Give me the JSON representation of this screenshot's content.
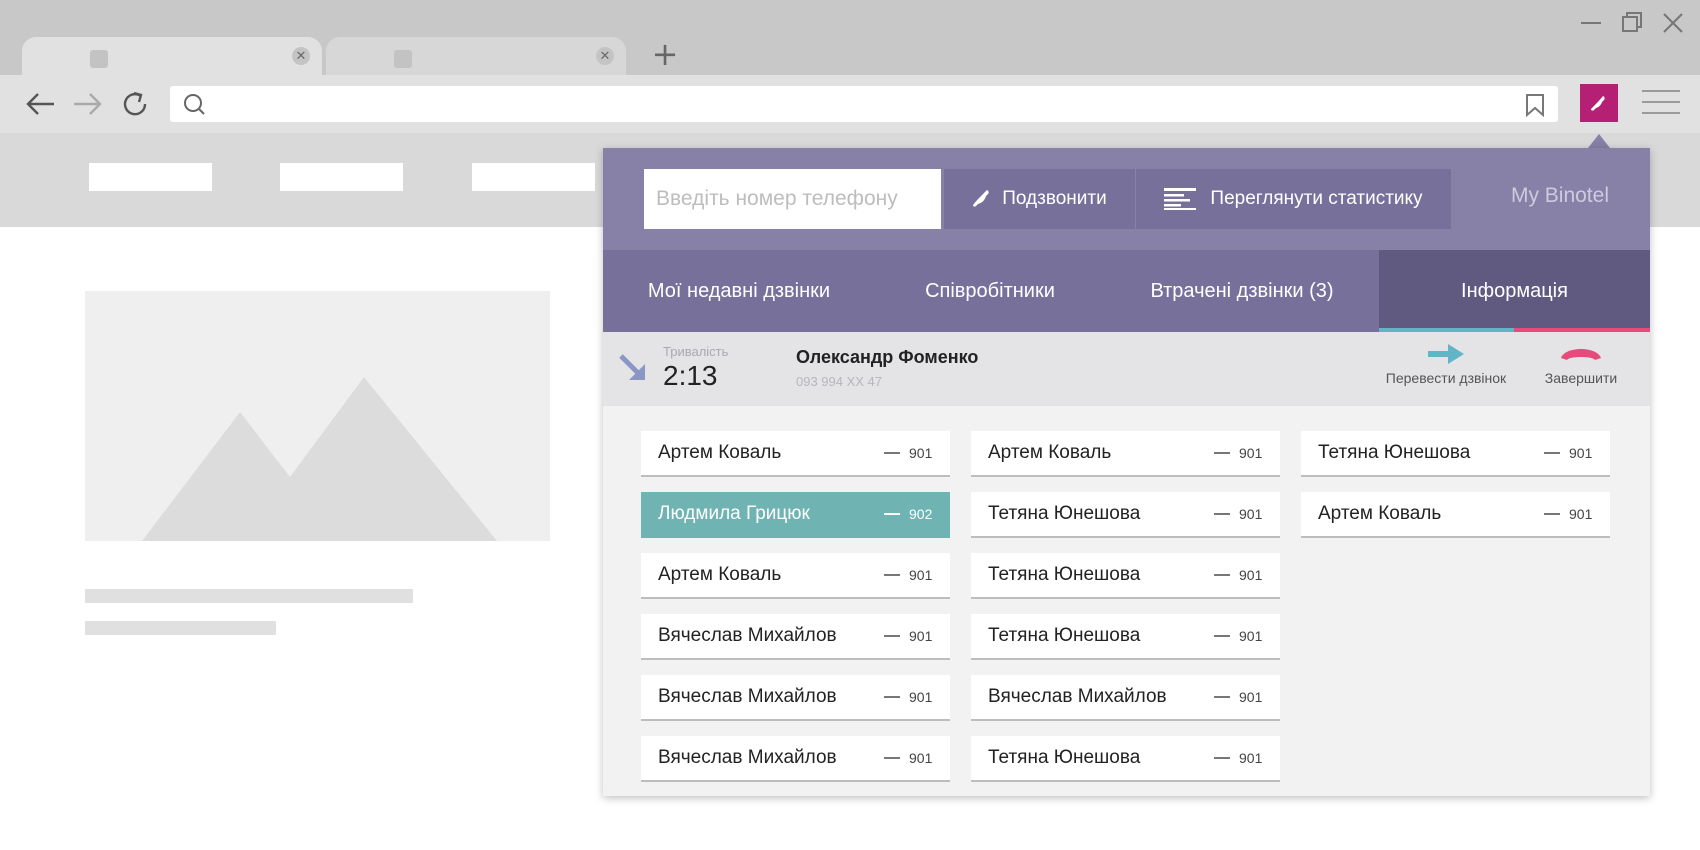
{
  "browser": {
    "tabs": [
      {
        "state": "active",
        "close_glyph": "✕"
      },
      {
        "state": "inactive",
        "close_glyph": "✕"
      }
    ],
    "new_tab_glyph": "+"
  },
  "popup": {
    "phone_placeholder": "Введіть номер телефону",
    "call_button": "Подзвонити",
    "stats_button": "Переглянути статистику",
    "my_binotel": "My Binotel",
    "tabs": [
      "Мої недавні дзвінки",
      "Співробітники",
      "Втрачені дзвінки (3)",
      "Інформація"
    ],
    "active_tab": "Інформація",
    "call": {
      "duration_label": "Тривалість",
      "duration": "2:13",
      "caller_name": "Олександр Фоменко",
      "caller_phone": "093 994 XX 47",
      "transfer_label": "Перевести дзвінок",
      "end_label": "Завершити"
    },
    "employees": [
      [
        {
          "name": "Артем Коваль",
          "ext": "901"
        },
        {
          "name": "Людмила Грицюк",
          "ext": "902",
          "active": true
        },
        {
          "name": "Артем Коваль",
          "ext": "901"
        },
        {
          "name": "Вячеслав Михайлов",
          "ext": "901"
        },
        {
          "name": "Вячеслав Михайлов",
          "ext": "901"
        },
        {
          "name": "Вячеслав Михайлов",
          "ext": "901"
        }
      ],
      [
        {
          "name": "Артем Коваль",
          "ext": "901"
        },
        {
          "name": "Тетяна Юнешова",
          "ext": "901"
        },
        {
          "name": "Тетяна Юнешова",
          "ext": "901"
        },
        {
          "name": "Тетяна Юнешова",
          "ext": "901"
        },
        {
          "name": "Вячеслав Михайлов",
          "ext": "901"
        },
        {
          "name": "Тетяна Юнешова",
          "ext": "901"
        }
      ],
      [
        {
          "name": "Тетяна Юнешова",
          "ext": "901"
        },
        {
          "name": "Артем Коваль",
          "ext": "901"
        }
      ]
    ]
  },
  "colors": {
    "accent": "#b51f74",
    "panel_header": "#8780a7",
    "tabs_bar": "#77709a",
    "active_tab": "#615a80",
    "selected_employee": "#70b3b3",
    "transfer": "#62b5c6",
    "end_call": "#e54b7b"
  }
}
